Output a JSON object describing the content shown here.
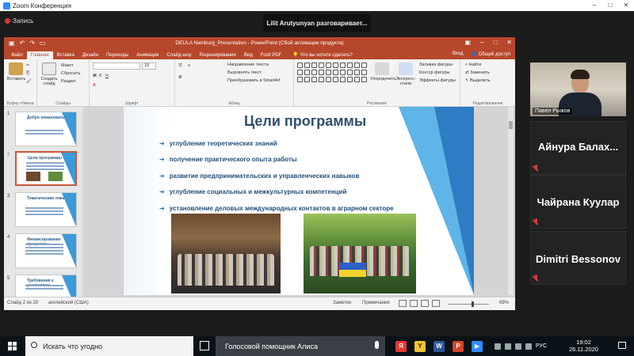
{
  "zoom": {
    "window_title": "Zoom Конференция",
    "record_label": "Запись",
    "speaking_banner": "Lilit Arutyunyan разговаривает..."
  },
  "ppt": {
    "title": "DEULA Nienburg_Presentation - PowerPoint (Сбой активации продукта)",
    "tabs": [
      "Файл",
      "Главная",
      "Вставка",
      "Дизайн",
      "Переходы",
      "Анимация",
      "Слайд-шоу",
      "Рецензирование",
      "Вид",
      "Foxit PDF"
    ],
    "active_tab": "Главная",
    "tell_me": "Что вы хотите сделать?",
    "login": "Вход",
    "share": "Общий доступ",
    "ribbon": {
      "paste": "Вставить",
      "clipboard": "Буфер обмена",
      "create_slide": "Создать слайд",
      "layout": "Макет",
      "reset": "Сбросить",
      "section": "Раздел",
      "slides_group": "Слайды",
      "font_group": "Шрифт",
      "font_size": "18",
      "text_direction": "Направление текста",
      "align_text": "Выровнять текст",
      "smartart": "Преобразовать в SmartArt",
      "paragraph_group": "Абзац",
      "arrange": "Упорядочить",
      "quick_styles": "Экспресс-стили",
      "shape_fill": "Заливка фигуры",
      "shape_outline": "Контур фигуры",
      "shape_effects": "Эффекты фигуры",
      "drawing_group": "Рисование",
      "find": "Найти",
      "replace": "Заменить",
      "select": "Выделить",
      "editing_group": "Редактирование"
    },
    "thumbnails": [
      {
        "num": "1",
        "title": "Добро пожаловать!"
      },
      {
        "num": "2",
        "title": "Цели программы"
      },
      {
        "num": "3",
        "title": "Тематические темы"
      },
      {
        "num": "4",
        "title": "Финансирование программы"
      },
      {
        "num": "5",
        "title": "Требования к участникам"
      }
    ],
    "slide": {
      "title": "Цели программы",
      "bullets": [
        "углубление теоретических знаний",
        "получение практического опыта работы",
        "развитие предпринимательских и управленческих навыков",
        "углубление социальных и межкультурных компетенций",
        "установление деловых международных контактов в аграрном секторе"
      ]
    },
    "status": {
      "slide_of": "Слайд 2 из 20",
      "language": "английский (США)",
      "notes": "Заметки",
      "comments": "Примечания",
      "zoom": "69%"
    }
  },
  "participants": {
    "video_name": "Павел Рыжов",
    "names": [
      "Айнура Балах...",
      "Чайрана Куулар",
      "Dimitri Bessonov"
    ]
  },
  "taskbar": {
    "search_placeholder": "Искать что угодно",
    "alice": "Голосовой помощник Алиса",
    "lang": "РУС",
    "time": "19:02",
    "date": "26.11.2020"
  },
  "colors": {
    "ppt_accent": "#b7472a",
    "slide_blue": "#2e7cc4",
    "zoom_blue": "#2d8cff",
    "muted_red": "#e03b3b"
  }
}
